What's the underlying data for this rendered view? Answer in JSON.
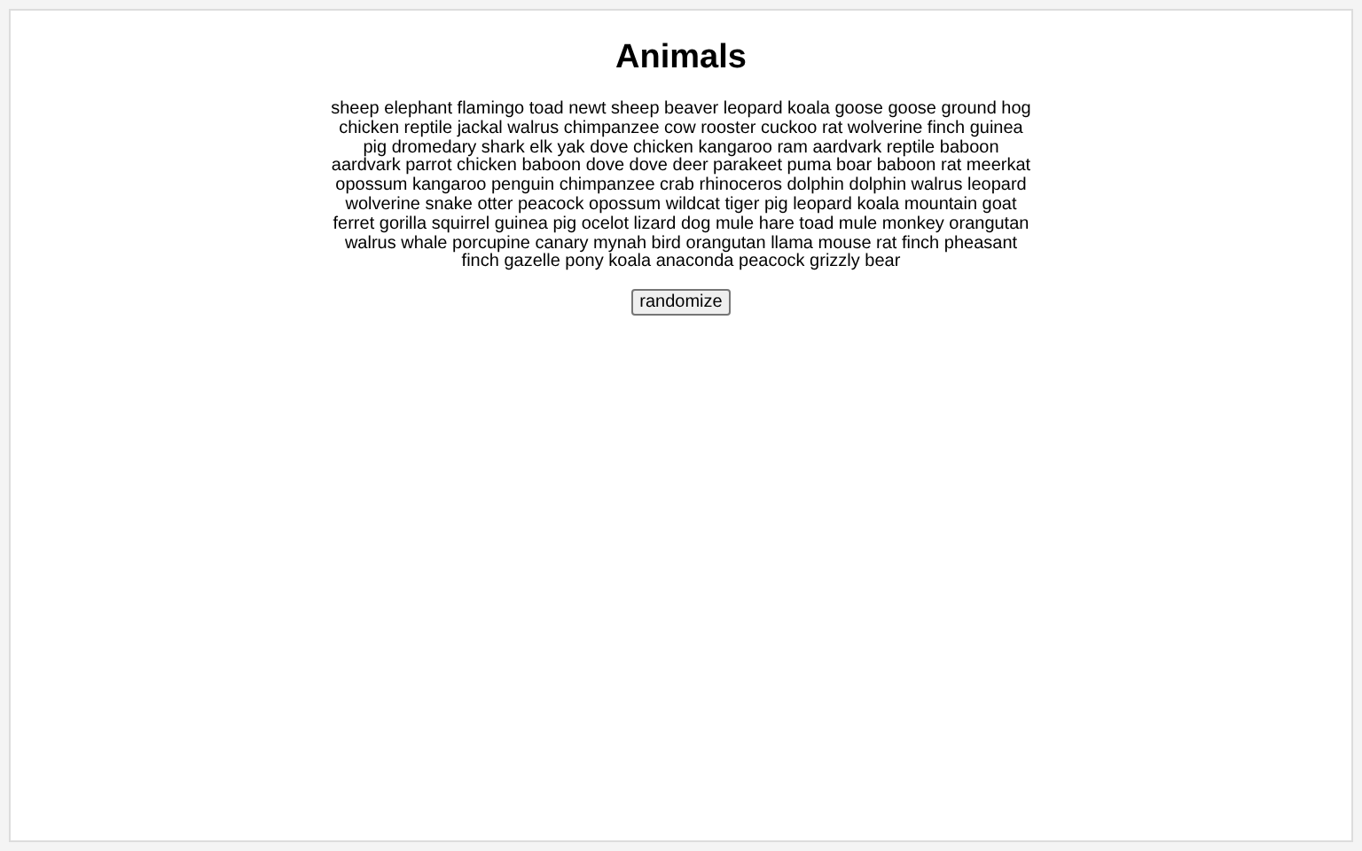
{
  "title": "Animals",
  "animals": "sheep elephant flamingo toad newt sheep beaver leopard koala goose goose ground hog chicken reptile jackal walrus chimpanzee cow rooster cuckoo rat wolverine finch guinea pig dromedary shark elk yak dove chicken kangaroo ram aardvark reptile baboon aardvark parrot chicken baboon dove dove deer parakeet puma boar baboon rat meerkat opossum kangaroo penguin chimpanzee crab rhinoceros dolphin dolphin walrus leopard wolverine snake otter peacock opossum wildcat tiger pig leopard koala mountain goat ferret gorilla squirrel guinea pig ocelot lizard dog mule hare toad mule monkey orangutan walrus whale porcupine canary mynah bird orangutan llama mouse rat finch pheasant finch gazelle pony koala anaconda peacock grizzly bear",
  "button": "randomize"
}
